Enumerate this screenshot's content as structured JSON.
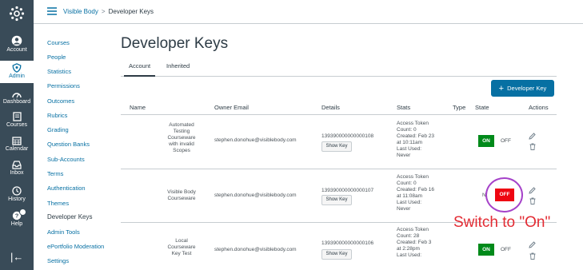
{
  "global_nav": {
    "items": [
      {
        "label": "Account"
      },
      {
        "label": "Admin"
      },
      {
        "label": "Dashboard"
      },
      {
        "label": "Courses"
      },
      {
        "label": "Calendar"
      },
      {
        "label": "Inbox"
      },
      {
        "label": "History"
      },
      {
        "label": "Help"
      }
    ],
    "collapse_glyph": "|←"
  },
  "header": {
    "breadcrumb": {
      "account": "Visible Body",
      "separator": ">",
      "current": "Developer Keys"
    }
  },
  "sidebar": {
    "items": [
      {
        "label": "Courses"
      },
      {
        "label": "People"
      },
      {
        "label": "Statistics"
      },
      {
        "label": "Permissions"
      },
      {
        "label": "Outcomes"
      },
      {
        "label": "Rubrics"
      },
      {
        "label": "Grading"
      },
      {
        "label": "Question Banks"
      },
      {
        "label": "Sub-Accounts"
      },
      {
        "label": "Terms"
      },
      {
        "label": "Authentication"
      },
      {
        "label": "Themes"
      },
      {
        "label": "Developer Keys"
      },
      {
        "label": "Admin Tools"
      },
      {
        "label": "ePortfolio Moderation"
      },
      {
        "label": "Settings"
      }
    ]
  },
  "main": {
    "title": "Developer Keys",
    "tabs": [
      {
        "label": "Account"
      },
      {
        "label": "Inherited"
      }
    ],
    "add_button_label": "Developer Key",
    "columns": {
      "name": "Name",
      "owner": "Owner Email",
      "details": "Details",
      "stats": "Stats",
      "type": "Type",
      "state": "State",
      "actions": "Actions"
    },
    "rows": [
      {
        "name_lines": [
          "Automated",
          "Testing",
          "Courseware",
          "with invalid",
          "Scopes"
        ],
        "owner": "stephen.donohue@visiblebody.com",
        "key_id": "139390000000000108",
        "show_key": "Show Key",
        "stats_lines": [
          "Access Token",
          "Count: 0",
          "Created: Feb 23",
          "at 10:11am",
          "Last Used:",
          "Never"
        ],
        "state_on": "ON",
        "state_off": "OFF"
      },
      {
        "name_lines": [
          "Visible Body",
          "Courseware"
        ],
        "owner": "stephen.donohue@visiblebody.com",
        "key_id": "139390000000000107",
        "show_key": "Show Key",
        "stats_lines": [
          "Access Token",
          "Count: 0",
          "Created: Feb 16",
          "at 11:08am",
          "Last Used:",
          "Never"
        ],
        "state_on": "N",
        "state_off": "OFF"
      },
      {
        "name_lines": [
          "Local",
          "Courseware",
          "Key Test"
        ],
        "owner": "stephen.donohue@visiblebody.com",
        "key_id": "139390000000000106",
        "show_key": "Show Key",
        "stats_lines": [
          "Access Token",
          "Count: 28",
          "Created: Feb 3",
          "at 2:28pm",
          "Last Used:"
        ],
        "state_on": "ON",
        "state_off": "OFF"
      }
    ]
  },
  "annotation": {
    "text": "Switch to \"On\""
  },
  "colors": {
    "nav_bg": "#394b58",
    "link": "#0770a3",
    "toggle_on": "#008a1a",
    "toggle_off": "#ee0612",
    "annotation_red": "#e32b33",
    "highlight_purple": "#a542c9"
  }
}
